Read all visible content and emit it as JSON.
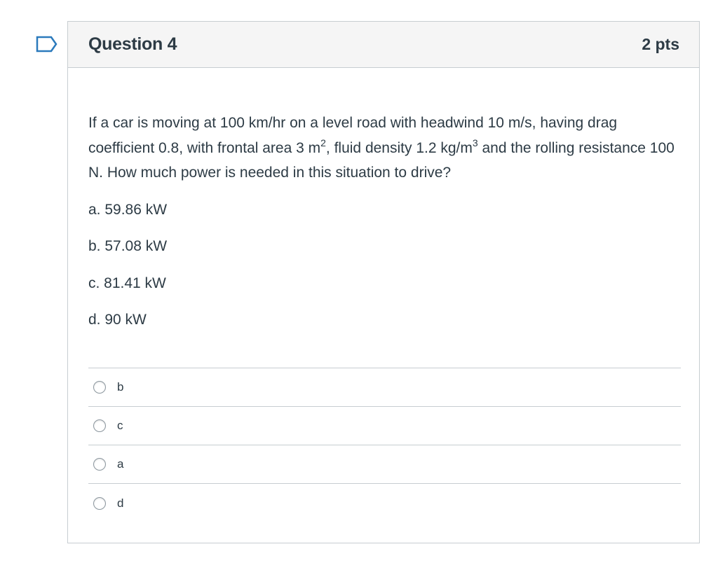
{
  "question": {
    "title": "Question 4",
    "points": "2 pts",
    "text_part1": "If a car is moving at 100 km/hr on a level road with headwind 10 m/s, having drag coefficient 0.8, with frontal area 3 m",
    "sup1": "2",
    "text_part2": ", fluid density 1.2 kg/m",
    "sup2": "3",
    "text_part3": " and the rolling resistance 100 N. How much power is needed in this situation to drive?",
    "options": [
      "a. 59.86 kW",
      "b. 57.08 kW",
      "c. 81.41 kW",
      "d. 90 kW"
    ]
  },
  "answers": [
    {
      "label": "b",
      "selected": false
    },
    {
      "label": "c",
      "selected": false
    },
    {
      "label": "a",
      "selected": false
    },
    {
      "label": "d",
      "selected": false
    }
  ],
  "icons": {
    "flag": "bookmark-flag-icon"
  },
  "colors": {
    "flag_outline": "#2b7abc",
    "border": "#c7cdd1",
    "header_bg": "#f5f5f5",
    "text": "#2d3b45"
  }
}
